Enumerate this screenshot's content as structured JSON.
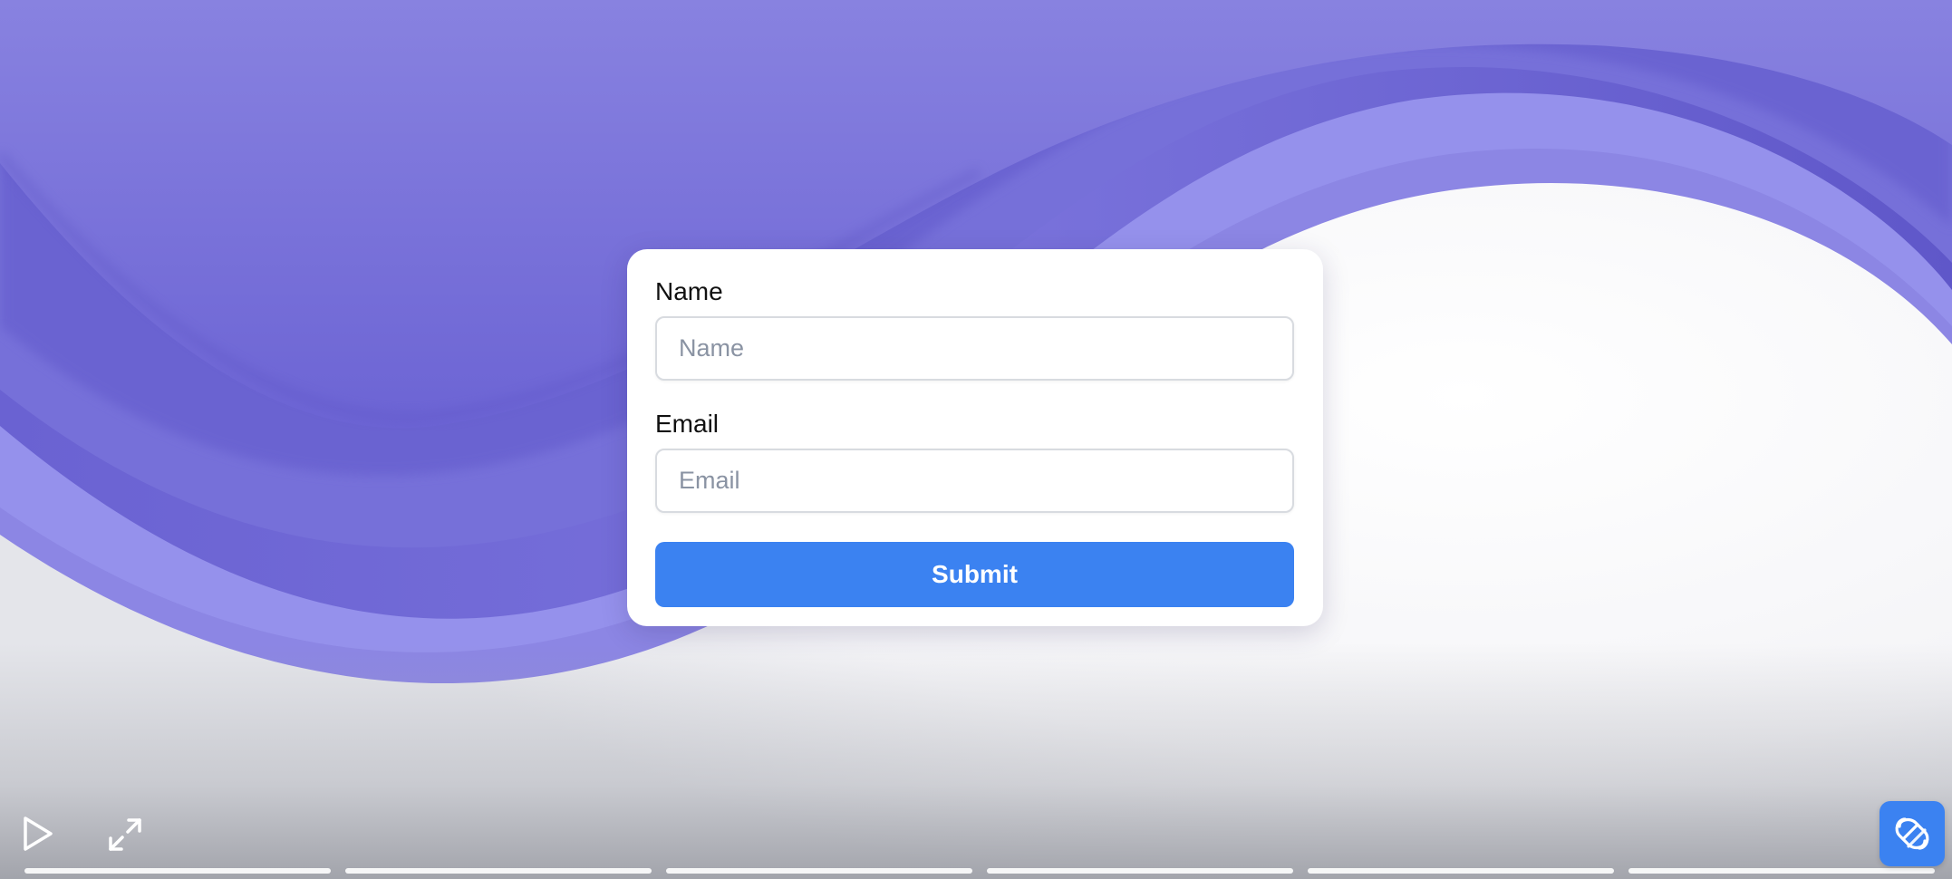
{
  "form": {
    "name_label": "Name",
    "name_placeholder": "Name",
    "name_value": "",
    "email_label": "Email",
    "email_placeholder": "Email",
    "email_value": "",
    "submit_label": "Submit"
  },
  "player": {
    "play_icon": "play-icon",
    "fullscreen_icon": "expand-icon",
    "brand_icon": "brand-logo-icon",
    "progress_segments": 6
  },
  "colors": {
    "accent": "#3b82f1",
    "wave_primary": "#7b74dc",
    "wave_dark": "#5d54c6",
    "wave_light": "#9590ea"
  }
}
